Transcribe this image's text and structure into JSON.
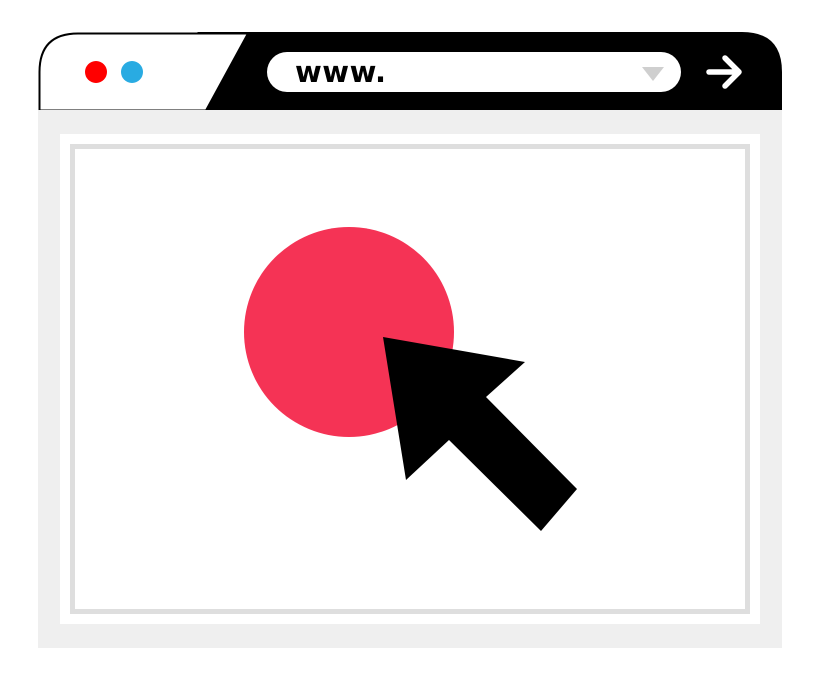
{
  "window": {
    "controls": [
      {
        "name": "close",
        "color": "#ff0000"
      },
      {
        "name": "minimize",
        "color": "#29abe2"
      }
    ]
  },
  "address_bar": {
    "value": "www.",
    "dropdown_icon": "triangle-down-icon"
  },
  "navigation": {
    "go_icon": "arrow-right-icon"
  },
  "content": {
    "shape": "circle",
    "shape_color": "#f53355",
    "pointer_icon": "mouse-pointer-icon"
  },
  "colors": {
    "chrome": "#000000",
    "tab": "#ffffff",
    "frame": "#efefef",
    "inner_border": "#dedede"
  }
}
